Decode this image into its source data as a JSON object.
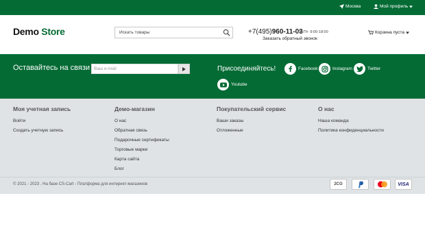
{
  "topbar": {
    "location": "Москва",
    "profile": "Мой профиль"
  },
  "header": {
    "logo_part1": "Demo",
    "logo_part2": "Store",
    "search_placeholder": "Искать товары",
    "phone_prefix": "+7(495)",
    "phone_number": "960-11-03",
    "hours": "Пн-Пт: 9:00-18:00",
    "callback": "Заказать обратный звонок",
    "cart": "Корзина пуста"
  },
  "newsletter": {
    "title": "Оставайтесь на связи",
    "email_placeholder": "Ваш e-mail",
    "join_title": "Присоединяйтесь!",
    "social": [
      {
        "label": "Facebook",
        "icon": "facebook-icon"
      },
      {
        "label": "Instagram",
        "icon": "instagram-icon"
      },
      {
        "label": "Twitter",
        "icon": "twitter-icon"
      },
      {
        "label": "Youtube",
        "icon": "youtube-icon"
      }
    ]
  },
  "footer": {
    "columns": [
      {
        "title": "Моя учетная запись",
        "links": [
          "Войти",
          "Создать учетную запись"
        ]
      },
      {
        "title": "Демо-магазин",
        "links": [
          "О нас",
          "Обратная связь",
          "Подарочные сертификаты",
          "Торговые марки",
          "Карта сайта",
          "Блог"
        ]
      },
      {
        "title": "Покупательский сервис",
        "links": [
          "Ваши заказы",
          "Отложенные"
        ]
      },
      {
        "title": "О нас",
        "links": [
          "Наша команда",
          "Политика конфиденциальности"
        ]
      }
    ],
    "copyright": "© 2021 - 2023 .  На базе CS-Cart - Платформа для интернет-магазинов",
    "payments": [
      "2CO",
      "PayPal",
      "MasterCard",
      "VISA"
    ]
  },
  "colors": {
    "brand_green": "#056b35",
    "footer_bg": "#dfe3e6"
  }
}
